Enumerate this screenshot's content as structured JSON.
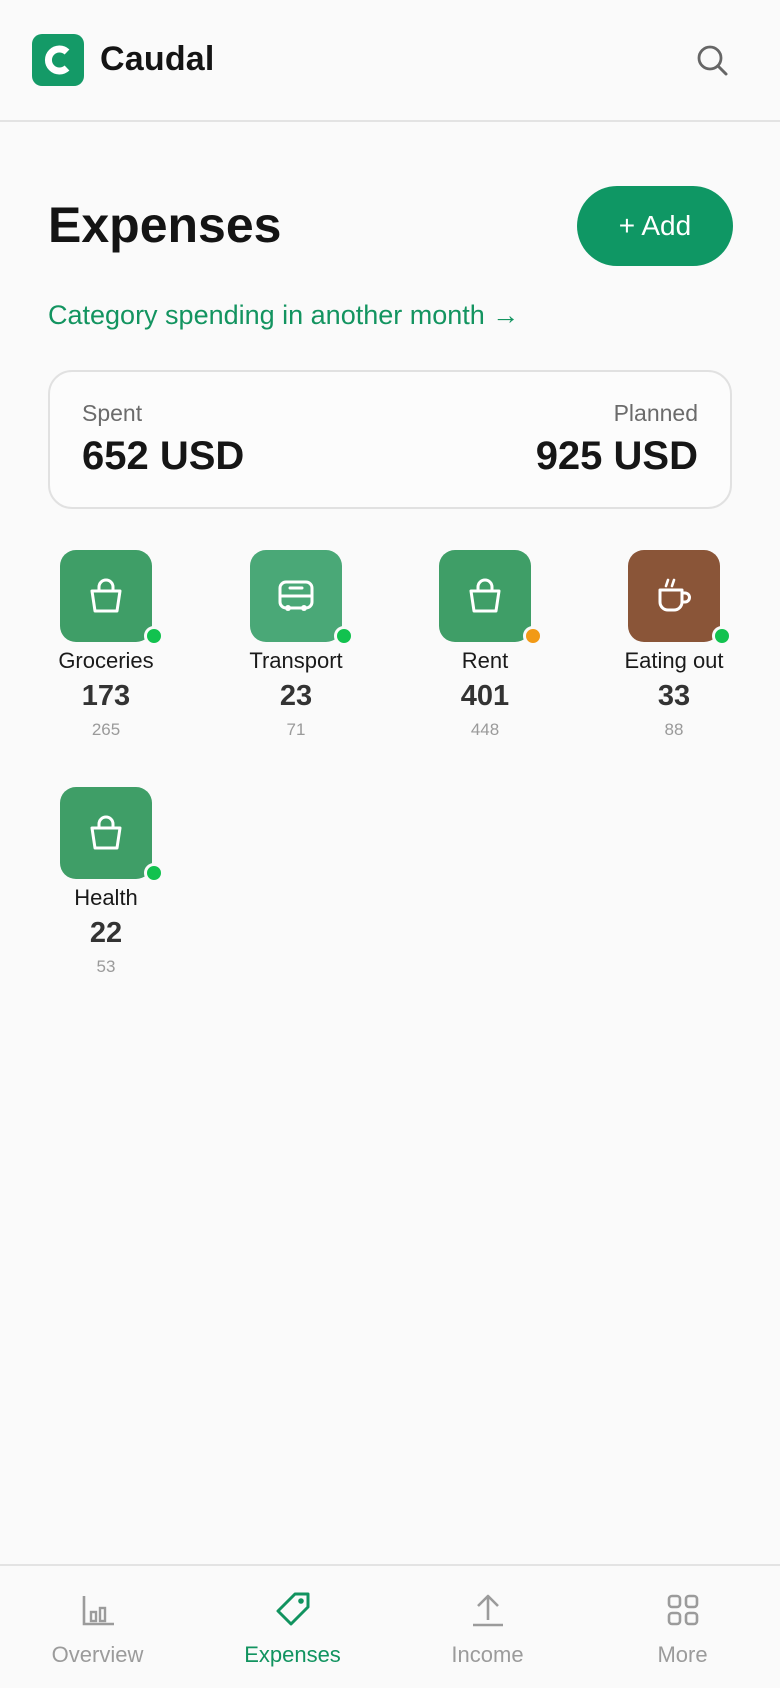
{
  "header": {
    "brand": "Caudal",
    "logo_letter_icon": "c-logo-icon",
    "search_icon": "search-icon"
  },
  "main": {
    "title": "Expenses",
    "add_label": "+ Add",
    "month_link": "Category spending in another month →"
  },
  "summary": {
    "spent_label": "Spent",
    "spent_value": "652 USD",
    "planned_label": "Planned",
    "planned_value": "925 USD"
  },
  "categories": [
    {
      "name": "Groceries",
      "spent": "173",
      "planned": "265",
      "icon": "shopping-bag-icon",
      "color": "#3f9e67",
      "status_color": "#12c24f"
    },
    {
      "name": "Transport",
      "spent": "23",
      "planned": "71",
      "icon": "bus-icon",
      "color": "#4aa877",
      "status_color": "#12c24f"
    },
    {
      "name": "Rent",
      "spent": "401",
      "planned": "448",
      "icon": "shopping-bag-icon",
      "color": "#3f9e67",
      "status_color": "#f29a16"
    },
    {
      "name": "Eating out",
      "spent": "33",
      "planned": "88",
      "icon": "coffee-cup-icon",
      "color": "#8a5538",
      "status_color": "#12c24f"
    },
    {
      "name": "Health",
      "spent": "22",
      "planned": "53",
      "icon": "shopping-bag-icon",
      "color": "#3f9e67",
      "status_color": "#12c24f"
    }
  ],
  "bottom_nav": [
    {
      "label": "Overview",
      "icon": "bar-chart-icon",
      "active": false
    },
    {
      "label": "Expenses",
      "icon": "tag-icon",
      "active": true
    },
    {
      "label": "Income",
      "icon": "upload-icon",
      "active": false
    },
    {
      "label": "More",
      "icon": "grid-icon",
      "active": false
    }
  ],
  "colors": {
    "accent": "#0f9764",
    "brand_logo": "#149a67",
    "nav_inactive": "#9b9b9b"
  }
}
